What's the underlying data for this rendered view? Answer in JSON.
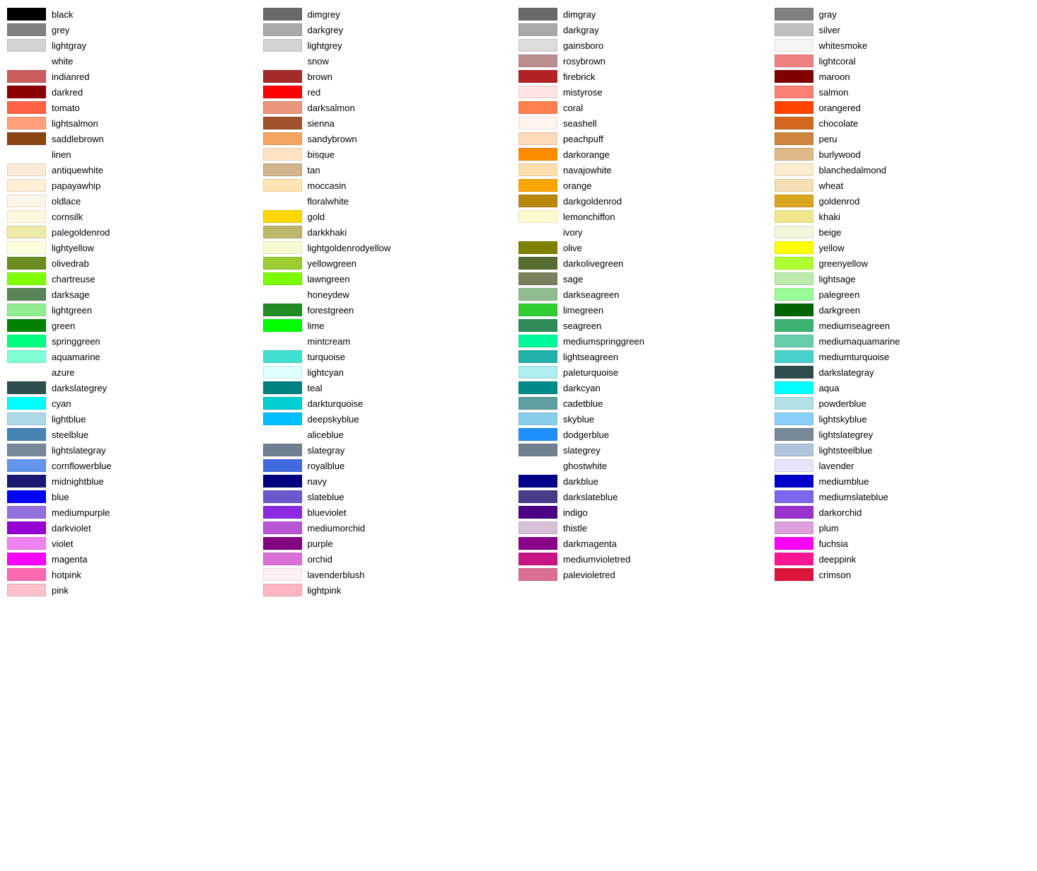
{
  "columns": [
    [
      {
        "name": "black",
        "color": "#000000"
      },
      {
        "name": "grey",
        "color": "#808080"
      },
      {
        "name": "lightgray",
        "color": "#d3d3d3"
      },
      {
        "name": "white",
        "color": ""
      },
      {
        "name": "indianred",
        "color": "#cd5c5c"
      },
      {
        "name": "darkred",
        "color": "#8b0000"
      },
      {
        "name": "tomato",
        "color": "#ff6347"
      },
      {
        "name": "lightsalmon",
        "color": "#ffa07a"
      },
      {
        "name": "saddlebrown",
        "color": "#8b4513"
      },
      {
        "name": "linen",
        "color": ""
      },
      {
        "name": "antiquewhite",
        "color": "#faebd7"
      },
      {
        "name": "papayawhip",
        "color": "#ffefd5"
      },
      {
        "name": "oldlace",
        "color": "#fdf5e6"
      },
      {
        "name": "cornsilk",
        "color": "#fff8dc"
      },
      {
        "name": "palegoldenrod",
        "color": "#eee8aa"
      },
      {
        "name": "lightyellow",
        "color": "#ffffe0"
      },
      {
        "name": "olivedrab",
        "color": "#6b8e23"
      },
      {
        "name": "chartreuse",
        "color": "#7fff00"
      },
      {
        "name": "darksage",
        "color": "#598556"
      },
      {
        "name": "lightgreen",
        "color": "#90ee90"
      },
      {
        "name": "green",
        "color": "#008000"
      },
      {
        "name": "springgreen",
        "color": "#00ff7f"
      },
      {
        "name": "aquamarine",
        "color": "#7fffd4"
      },
      {
        "name": "azure",
        "color": ""
      },
      {
        "name": "darkslategrey",
        "color": "#2f4f4f"
      },
      {
        "name": "cyan",
        "color": "#00ffff"
      },
      {
        "name": "lightblue",
        "color": "#add8e6"
      },
      {
        "name": "steelblue",
        "color": "#4682b4"
      },
      {
        "name": "lightslategray",
        "color": "#778899"
      },
      {
        "name": "cornflowerblue",
        "color": "#6495ed"
      },
      {
        "name": "midnightblue",
        "color": "#191970"
      },
      {
        "name": "blue",
        "color": "#0000ff"
      },
      {
        "name": "mediumpurple",
        "color": "#9370db"
      },
      {
        "name": "darkviolet",
        "color": "#9400d3"
      },
      {
        "name": "violet",
        "color": "#ee82ee"
      },
      {
        "name": "magenta",
        "color": "#ff00ff"
      },
      {
        "name": "hotpink",
        "color": "#ff69b4"
      },
      {
        "name": "pink",
        "color": "#ffc0cb"
      }
    ],
    [
      {
        "name": "dimgrey",
        "color": "#696969"
      },
      {
        "name": "darkgrey",
        "color": "#a9a9a9"
      },
      {
        "name": "lightgrey",
        "color": "#d3d3d3"
      },
      {
        "name": "snow",
        "color": ""
      },
      {
        "name": "brown",
        "color": "#a52a2a"
      },
      {
        "name": "red",
        "color": "#ff0000"
      },
      {
        "name": "darksalmon",
        "color": "#e9967a"
      },
      {
        "name": "sienna",
        "color": "#a0522d"
      },
      {
        "name": "sandybrown",
        "color": "#f4a460"
      },
      {
        "name": "bisque",
        "color": "#ffe4c4"
      },
      {
        "name": "tan",
        "color": "#d2b48c"
      },
      {
        "name": "moccasin",
        "color": "#ffe4b5"
      },
      {
        "name": "floralwhite",
        "color": ""
      },
      {
        "name": "gold",
        "color": "#ffd700"
      },
      {
        "name": "darkkhaki",
        "color": "#bdb76b"
      },
      {
        "name": "lightgoldenrodyellow",
        "color": "#fafad2"
      },
      {
        "name": "yellowgreen",
        "color": "#9acd32"
      },
      {
        "name": "lawngreen",
        "color": "#7cfc00"
      },
      {
        "name": "honeydew",
        "color": ""
      },
      {
        "name": "forestgreen",
        "color": "#228b22"
      },
      {
        "name": "lime",
        "color": "#00ff00"
      },
      {
        "name": "mintcream",
        "color": ""
      },
      {
        "name": "turquoise",
        "color": "#40e0d0"
      },
      {
        "name": "lightcyan",
        "color": "#e0ffff"
      },
      {
        "name": "teal",
        "color": "#008080"
      },
      {
        "name": "darkturquoise",
        "color": "#00ced1"
      },
      {
        "name": "deepskyblue",
        "color": "#00bfff"
      },
      {
        "name": "aliceblue",
        "color": ""
      },
      {
        "name": "slategray",
        "color": "#708090"
      },
      {
        "name": "royalblue",
        "color": "#4169e1"
      },
      {
        "name": "navy",
        "color": "#000080"
      },
      {
        "name": "slateblue",
        "color": "#6a5acd"
      },
      {
        "name": "blueviolet",
        "color": "#8a2be2"
      },
      {
        "name": "mediumorchid",
        "color": "#ba55d3"
      },
      {
        "name": "purple",
        "color": "#800080"
      },
      {
        "name": "orchid",
        "color": "#da70d6"
      },
      {
        "name": "lavenderblush",
        "color": "#fff0f5"
      },
      {
        "name": "lightpink",
        "color": "#ffb6c1"
      }
    ],
    [
      {
        "name": "dimgray",
        "color": "#696969"
      },
      {
        "name": "darkgray",
        "color": "#a9a9a9"
      },
      {
        "name": "gainsboro",
        "color": "#dcdcdc"
      },
      {
        "name": "rosybrown",
        "color": "#bc8f8f"
      },
      {
        "name": "firebrick",
        "color": "#b22222"
      },
      {
        "name": "mistyrose",
        "color": "#ffe4e1"
      },
      {
        "name": "coral",
        "color": "#ff7f50"
      },
      {
        "name": "seashell",
        "color": "#fff5ee"
      },
      {
        "name": "peachpuff",
        "color": "#ffdab9"
      },
      {
        "name": "darkorange",
        "color": "#ff8c00"
      },
      {
        "name": "navajowhite",
        "color": "#ffdead"
      },
      {
        "name": "orange",
        "color": "#ffa500"
      },
      {
        "name": "darkgoldenrod",
        "color": "#b8860b"
      },
      {
        "name": "lemonchiffon",
        "color": "#fffacd"
      },
      {
        "name": "ivory",
        "color": ""
      },
      {
        "name": "olive",
        "color": "#808000"
      },
      {
        "name": "darkolivegreen",
        "color": "#556b2f"
      },
      {
        "name": "sage",
        "color": "#77815c"
      },
      {
        "name": "darkseagreen",
        "color": "#8fbc8f"
      },
      {
        "name": "limegreen",
        "color": "#32cd32"
      },
      {
        "name": "seagreen",
        "color": "#2e8b57"
      },
      {
        "name": "mediumspringgreen",
        "color": "#00fa9a"
      },
      {
        "name": "lightseagreen",
        "color": "#20b2aa"
      },
      {
        "name": "paleturquoise",
        "color": "#afeeee"
      },
      {
        "name": "darkcyan",
        "color": "#008b8b"
      },
      {
        "name": "cadetblue",
        "color": "#5f9ea0"
      },
      {
        "name": "skyblue",
        "color": "#87ceeb"
      },
      {
        "name": "dodgerblue",
        "color": "#1e90ff"
      },
      {
        "name": "slategrey",
        "color": "#708090"
      },
      {
        "name": "ghostwhite",
        "color": ""
      },
      {
        "name": "darkblue",
        "color": "#00008b"
      },
      {
        "name": "darkslateblue",
        "color": "#483d8b"
      },
      {
        "name": "indigo",
        "color": "#4b0082"
      },
      {
        "name": "thistle",
        "color": "#d8bfd8"
      },
      {
        "name": "darkmagenta",
        "color": "#8b008b"
      },
      {
        "name": "mediumvioletred",
        "color": "#c71585"
      },
      {
        "name": "palevioletred",
        "color": "#db7093"
      }
    ],
    [
      {
        "name": "gray",
        "color": "#808080"
      },
      {
        "name": "silver",
        "color": "#c0c0c0"
      },
      {
        "name": "whitesmoke",
        "color": "#f5f5f5"
      },
      {
        "name": "lightcoral",
        "color": "#f08080"
      },
      {
        "name": "maroon",
        "color": "#800000"
      },
      {
        "name": "salmon",
        "color": "#fa8072"
      },
      {
        "name": "orangered",
        "color": "#ff4500"
      },
      {
        "name": "chocolate",
        "color": "#d2691e"
      },
      {
        "name": "peru",
        "color": "#cd853f"
      },
      {
        "name": "burlywood",
        "color": "#deb887"
      },
      {
        "name": "blanchedalmond",
        "color": "#ffebcd"
      },
      {
        "name": "wheat",
        "color": "#f5deb3"
      },
      {
        "name": "goldenrod",
        "color": "#daa520"
      },
      {
        "name": "khaki",
        "color": "#f0e68c"
      },
      {
        "name": "beige",
        "color": "#f5f5dc"
      },
      {
        "name": "yellow",
        "color": "#ffff00"
      },
      {
        "name": "greenyellow",
        "color": "#adff2f"
      },
      {
        "name": "lightsage",
        "color": "#bcecac"
      },
      {
        "name": "palegreen",
        "color": "#98fb98"
      },
      {
        "name": "darkgreen",
        "color": "#006400"
      },
      {
        "name": "mediumseagreen",
        "color": "#3cb371"
      },
      {
        "name": "mediumaquamarine",
        "color": "#66cdaa"
      },
      {
        "name": "mediumturquoise",
        "color": "#48d1cc"
      },
      {
        "name": "darkslategray",
        "color": "#2f4f4f"
      },
      {
        "name": "aqua",
        "color": "#00ffff"
      },
      {
        "name": "powderblue",
        "color": "#b0e0e6"
      },
      {
        "name": "lightskyblue",
        "color": "#87cefa"
      },
      {
        "name": "lightslategrey",
        "color": "#778899"
      },
      {
        "name": "lightsteelblue",
        "color": "#b0c4de"
      },
      {
        "name": "lavender",
        "color": "#e6e6fa"
      },
      {
        "name": "mediumblue",
        "color": "#0000cd"
      },
      {
        "name": "mediumslateblue",
        "color": "#7b68ee"
      },
      {
        "name": "darkorchid",
        "color": "#9932cc"
      },
      {
        "name": "plum",
        "color": "#dda0dd"
      },
      {
        "name": "fuchsia",
        "color": "#ff00ff"
      },
      {
        "name": "deeppink",
        "color": "#ff1493"
      },
      {
        "name": "crimson",
        "color": "#dc143c"
      }
    ]
  ]
}
